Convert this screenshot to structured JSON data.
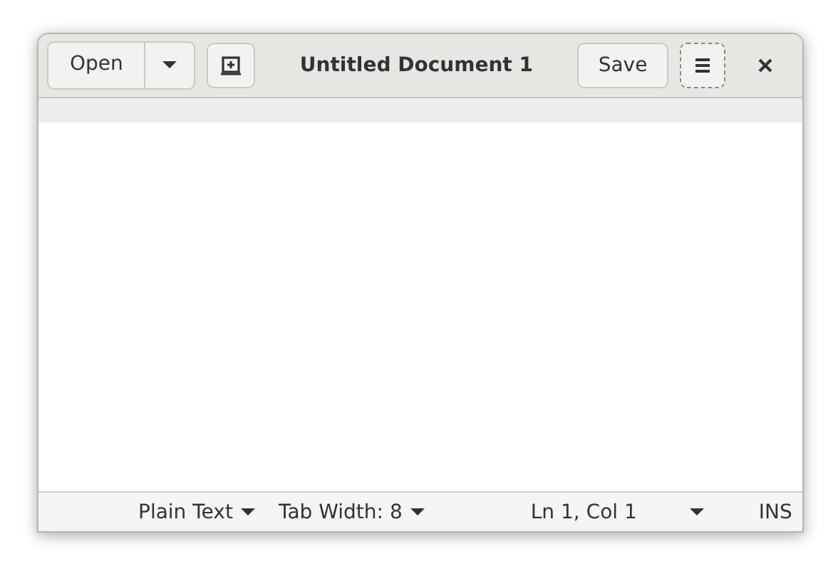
{
  "window": {
    "title": "Untitled Document 1"
  },
  "header": {
    "open_label": "Open",
    "save_label": "Save",
    "menu_focused": true
  },
  "status_bar": {
    "language": "Plain Text",
    "tab_width": "Tab Width: 8",
    "position": "Ln 1, Col 1",
    "mode": "INS"
  }
}
